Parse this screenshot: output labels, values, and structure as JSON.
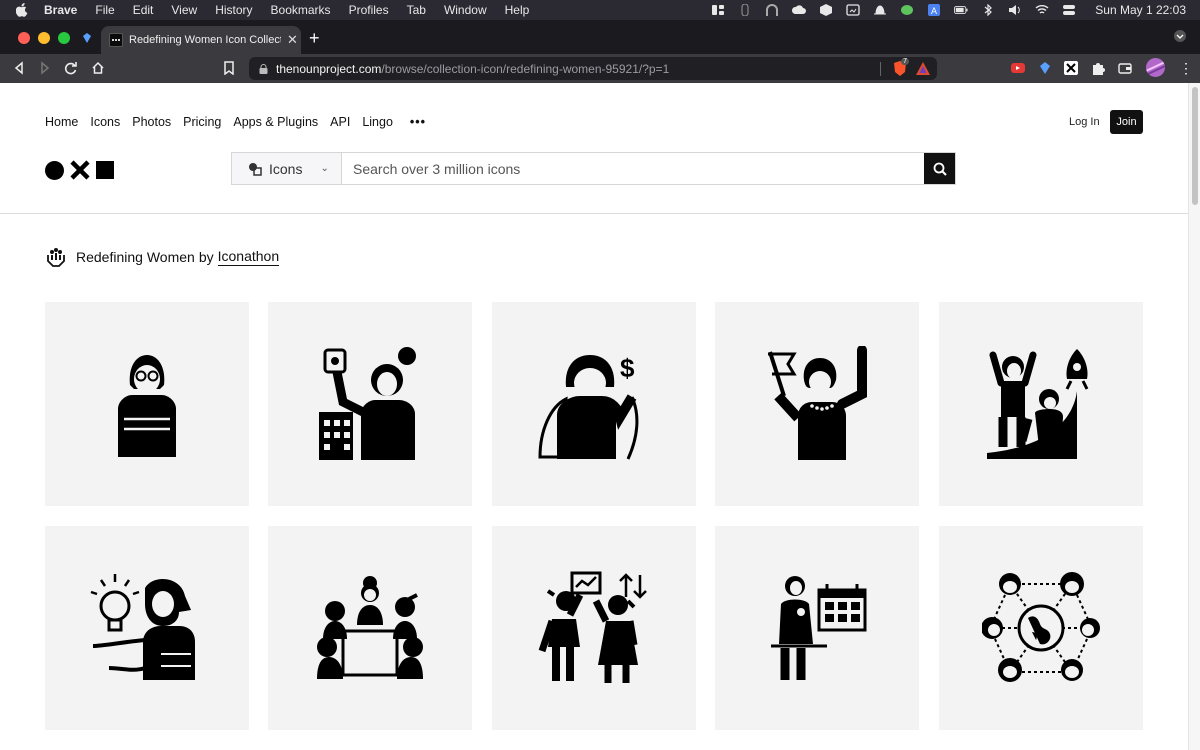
{
  "menubar": {
    "app_name": "Brave",
    "items": [
      "File",
      "Edit",
      "View",
      "History",
      "Bookmarks",
      "Profiles",
      "Tab",
      "Window",
      "Help"
    ],
    "clock": "Sun May 1  22:03"
  },
  "browser": {
    "tab_title": "Redefining Women Icon Collection",
    "url_host": "thenounproject.com",
    "url_path": "/browse/collection-icon/redefining-women-95921/?p=1",
    "shield_count": "7"
  },
  "site": {
    "nav": [
      "Home",
      "Icons",
      "Photos",
      "Pricing",
      "Apps & Plugins",
      "API",
      "Lingo"
    ],
    "more": "•••",
    "login": "Log In",
    "join": "Join",
    "search": {
      "type_label": "Icons",
      "placeholder": "Search over 3 million icons"
    },
    "collection": {
      "title": "Redefining Women",
      "by": "by",
      "author": "Iconathon"
    }
  },
  "icons": [
    {
      "name": "woman-arms-crossed-icon"
    },
    {
      "name": "woman-holding-money-building-icon"
    },
    {
      "name": "woman-superhero-dollar-icon"
    },
    {
      "name": "woman-raising-flag-icon"
    },
    {
      "name": "women-rocket-growth-icon"
    },
    {
      "name": "woman-lightbulb-idea-icon"
    },
    {
      "name": "women-meeting-table-icon"
    },
    {
      "name": "women-presenting-chart-icon"
    },
    {
      "name": "mother-child-calendar-icon"
    },
    {
      "name": "women-global-network-icon"
    }
  ],
  "colors": {
    "menubar_bg": "#2b2a33",
    "card_bg": "#f3f3f4",
    "accent_black": "#111111"
  }
}
